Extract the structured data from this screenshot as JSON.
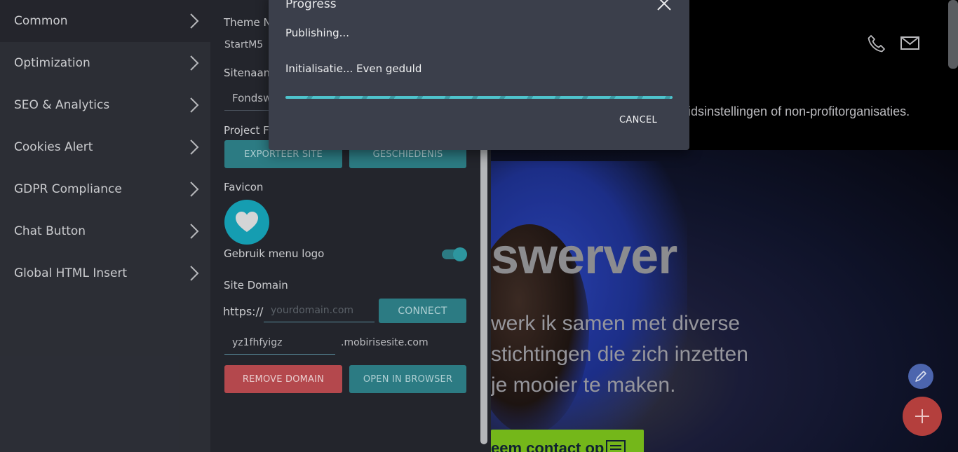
{
  "sidebar": {
    "items": [
      {
        "label": "Common"
      },
      {
        "label": "Optimization"
      },
      {
        "label": "SEO & Analytics"
      },
      {
        "label": "Cookies Alert"
      },
      {
        "label": "GDPR Compliance"
      },
      {
        "label": "Chat Button"
      },
      {
        "label": "Global HTML Insert"
      }
    ]
  },
  "panel": {
    "theme_label": "Theme Na",
    "theme_value": "StartM5",
    "sitename_label": "Sitenaam",
    "sitename_value": "Fondsw",
    "project_label": "Project Fi",
    "export_button": "EXPORTEER SITE",
    "history_button": "GESCHIEDENIS",
    "favicon_label": "Favicon",
    "menu_logo_label": "Gebruik menu logo",
    "menu_logo_enabled": true,
    "domain_label": "Site Domain",
    "https_prefix": "https://",
    "domain_placeholder": "yourdomain.com",
    "connect_button": "CONNECT",
    "subdomain_value": "yz1fhfyigz",
    "subdomain_suffix": ".mobirisesite.com",
    "remove_button": "REMOVE DOMAIN",
    "open_button": "OPEN IN BROWSER"
  },
  "preview": {
    "description": "idsinstellingen of non-profitorganisaties.",
    "headline": "swerver",
    "subtext_lines": [
      "werk ik samen met diverse",
      "stichtingen die zich inzetten",
      "je mooier te maken."
    ],
    "cta": "eem contact op"
  },
  "dialog": {
    "title": "Progress",
    "status": "Publishing...",
    "detail": "Initialisatie... Even geduld",
    "progress_percent": 100,
    "cancel": "CANCEL"
  },
  "colors": {
    "accent_teal": "#2d7e86",
    "danger_red": "#b84a4f",
    "fab_red": "#b8413f",
    "cta_green": "#77bb1b"
  }
}
